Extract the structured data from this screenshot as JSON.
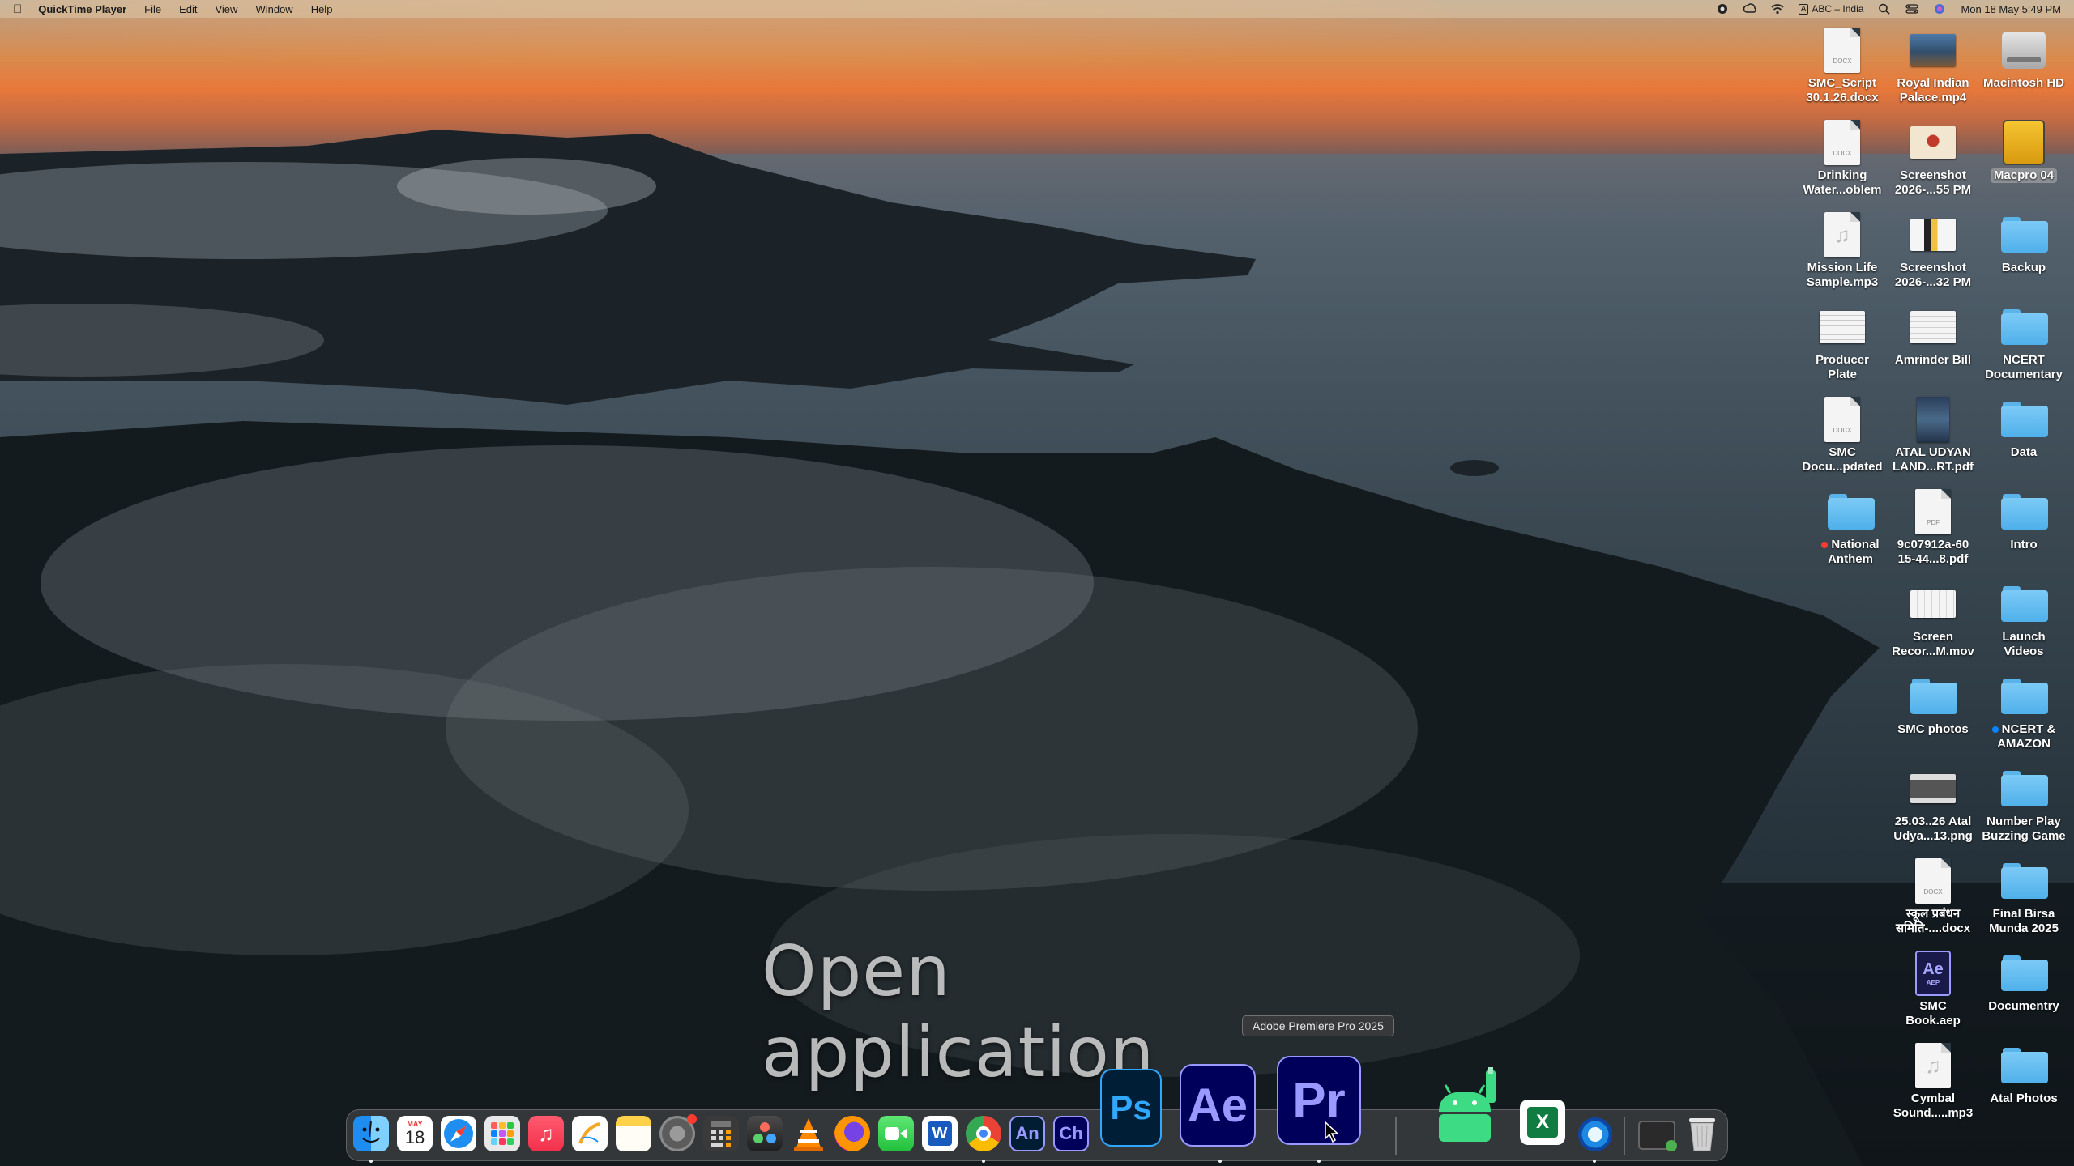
{
  "menubar": {
    "apple_icon": "apple-logo-icon",
    "app_name": "QuickTime Player",
    "menus": [
      "File",
      "Edit",
      "View",
      "Window",
      "Help"
    ],
    "input_source": "ABC – India",
    "clock": "Mon 18 May  5:49 PM"
  },
  "desktop": {
    "items": [
      {
        "label": "SMC_Script\n30.1.26.docx",
        "kind": "doc",
        "tag": "DOCX"
      },
      {
        "label": "Royal Indian\nPalace.mp4",
        "kind": "thumb-video"
      },
      {
        "label": "Macintosh HD",
        "kind": "disk"
      },
      {
        "label": "Drinking\nWater...oblem",
        "kind": "doc",
        "tag": "DOCX"
      },
      {
        "label": "Screenshot\n2026-...55 PM",
        "kind": "thumb-shot1"
      },
      {
        "label": "Macpro 04",
        "kind": "ext-disk",
        "selected": true
      },
      {
        "label": "Mission Life\nSample.mp3",
        "kind": "audio"
      },
      {
        "label": "Screenshot\n2026-...32 PM",
        "kind": "thumb-shot2"
      },
      {
        "label": "Backup",
        "kind": "folder"
      },
      {
        "label": "Producer\nPlate",
        "kind": "thumb-pdf"
      },
      {
        "label": "Amrinder Bill",
        "kind": "thumb-docx"
      },
      {
        "label": "NCERT\nDocumentary",
        "kind": "folder"
      },
      {
        "label": "SMC\nDocu...pdated",
        "kind": "doc",
        "tag": "DOCX"
      },
      {
        "label": "ATAL UDYAN\nLAND...RT.pdf",
        "kind": "thumb-book"
      },
      {
        "label": "Data",
        "kind": "folder"
      },
      {
        "label": "National\nAnthem",
        "kind": "folder",
        "tag_color": "#ff3b30"
      },
      {
        "label": "9c07912a-60\n15-44...8.pdf",
        "kind": "doc",
        "tag": "PDF"
      },
      {
        "label": "Intro",
        "kind": "folder"
      },
      {
        "label": "Screen\nRecor...M.mov",
        "kind": "thumb-rec"
      },
      {
        "label": "Launch\nVideos",
        "kind": "folder"
      },
      {
        "label": "SMC photos",
        "kind": "folder"
      },
      {
        "label": "NCERT &\nAMAZON",
        "kind": "folder",
        "tag_color": "#0a84ff"
      },
      {
        "label": "25.03..26 Atal\nUdya...13.png",
        "kind": "thumb-png"
      },
      {
        "label": "Number Play\nBuzzing Game",
        "kind": "folder"
      },
      {
        "label": "स्कूल प्रबंधन\nसमिति-....docx",
        "kind": "doc",
        "tag": "DOCX"
      },
      {
        "label": "Final Birsa\nMunda 2025",
        "kind": "folder"
      },
      {
        "label": "SMC\nBook.aep",
        "kind": "aep"
      },
      {
        "label": "Documentry",
        "kind": "folder"
      },
      {
        "label": "Cymbal\nSound.....mp3",
        "kind": "audio"
      },
      {
        "label": "Atal Photos",
        "kind": "folder"
      }
    ]
  },
  "caption": "Open application",
  "tooltip": "Adobe Premiere Pro 2025",
  "dock": {
    "calendar_month": "MAY",
    "calendar_day": "18",
    "items": [
      {
        "name": "finder-icon",
        "glyph": ""
      },
      {
        "name": "calendar-icon",
        "glyph": ""
      },
      {
        "name": "safari-icon",
        "glyph": ""
      },
      {
        "name": "launchpad-icon",
        "glyph": ""
      },
      {
        "name": "music-icon",
        "glyph": "♫"
      },
      {
        "name": "freeform-icon",
        "glyph": ""
      },
      {
        "name": "notes-icon",
        "glyph": ""
      },
      {
        "name": "system-settings-icon",
        "glyph": "⚙"
      },
      {
        "name": "calculator-icon",
        "glyph": ""
      },
      {
        "name": "davinci-resolve-icon",
        "glyph": ""
      },
      {
        "name": "vlc-icon",
        "glyph": ""
      },
      {
        "name": "firefox-icon",
        "glyph": ""
      },
      {
        "name": "facetime-icon",
        "glyph": ""
      },
      {
        "name": "word-icon",
        "glyph": "W"
      },
      {
        "name": "chrome-icon",
        "glyph": ""
      },
      {
        "name": "animate-icon",
        "glyph": "An"
      },
      {
        "name": "character-animator-icon",
        "glyph": "Ch"
      },
      {
        "name": "photoshop-icon",
        "glyph": "Ps"
      },
      {
        "name": "after-effects-icon",
        "glyph": "Ae"
      },
      {
        "name": "premiere-pro-icon",
        "glyph": "Pr"
      },
      {
        "name": "android-studio-icon",
        "glyph": ""
      },
      {
        "name": "excel-icon",
        "glyph": "X"
      },
      {
        "name": "quicktime-icon",
        "glyph": ""
      },
      {
        "name": "screen-capture-icon",
        "glyph": ""
      },
      {
        "name": "trash-icon",
        "glyph": ""
      }
    ]
  },
  "colors": {
    "folder": "#5ab4ea",
    "photoshop": "#31a8ff",
    "after_effects": "#9999ff",
    "premiere": "#9999ff",
    "adobe_bg": "#00005b"
  }
}
